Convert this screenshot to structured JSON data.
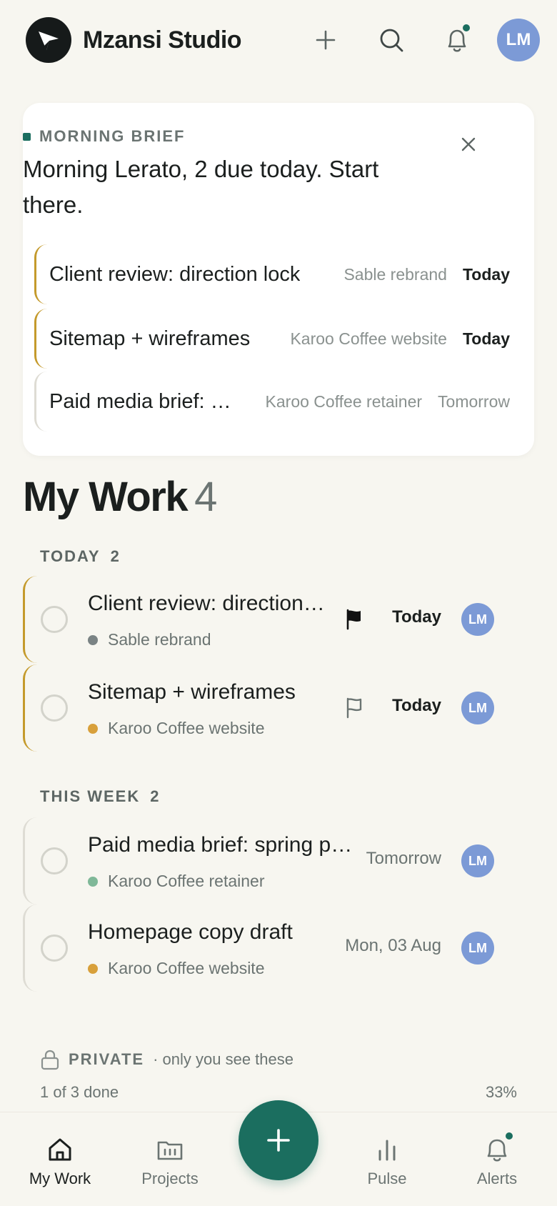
{
  "app": {
    "name": "Mzansi Studio",
    "user_initials": "LM"
  },
  "brief": {
    "label": "MORNING BRIEF",
    "message": "Morning Lerato, 2 due today. Start there.",
    "items": [
      {
        "title": "Client review: direction lock",
        "project": "Sable rebrand",
        "due": "Today"
      },
      {
        "title": "Sitemap + wireframes",
        "project": "Karoo Coffee website",
        "due": "Today"
      },
      {
        "title": "Paid media brief: …",
        "project": "Karoo Coffee retainer",
        "due": "Tomorrow"
      }
    ]
  },
  "my_work": {
    "title": "My Work",
    "count": "4",
    "sections": [
      {
        "label": "TODAY",
        "count": "2",
        "tasks": [
          {
            "title": "Client review: direction …",
            "project": "Sable rebrand",
            "project_color": "#7a8384",
            "flagged": true,
            "due": "Today",
            "assignee": "LM"
          },
          {
            "title": "Sitemap + wireframes",
            "project": "Karoo Coffee website",
            "project_color": "#d8a03b",
            "flagged": false,
            "due": "Today",
            "assignee": "LM"
          }
        ]
      },
      {
        "label": "THIS WEEK",
        "count": "2",
        "tasks": [
          {
            "title": "Paid media brief: spring pu…",
            "project": "Karoo Coffee retainer",
            "project_color": "#7fb898",
            "due": "Tomorrow",
            "assignee": "LM"
          },
          {
            "title": "Homepage copy draft",
            "project": "Karoo Coffee website",
            "project_color": "#d8a03b",
            "due": "Mon, 03 Aug",
            "assignee": "LM"
          }
        ]
      }
    ]
  },
  "private": {
    "label": "PRIVATE",
    "note": "· only you see these",
    "done_text": "1 of 3 done",
    "done_percent": "33%"
  },
  "nav": {
    "items": [
      {
        "label": "My Work",
        "icon": "home-icon",
        "active": true
      },
      {
        "label": "Projects",
        "icon": "folder-icon"
      },
      {
        "label": "Pulse",
        "icon": "bar-chart-icon"
      },
      {
        "label": "Alerts",
        "icon": "bell-icon"
      }
    ]
  },
  "colors": {
    "accent": "#1b6e5f",
    "due_today_border": "#c49a2c",
    "avatar": "#7c9ad6",
    "background": "#f7f6f0"
  }
}
